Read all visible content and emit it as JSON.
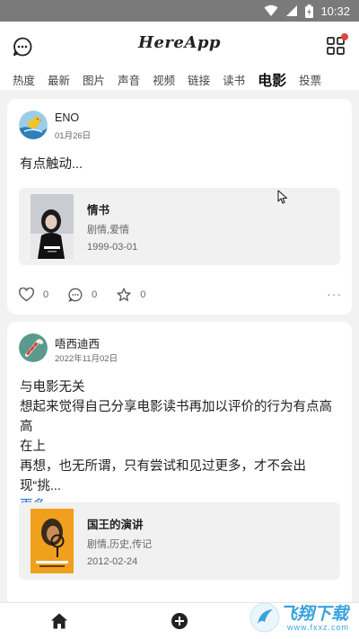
{
  "status": {
    "time": "10:32"
  },
  "header": {
    "title": "HereApp",
    "tabs": [
      {
        "label": "热度"
      },
      {
        "label": "最新"
      },
      {
        "label": "图片"
      },
      {
        "label": "声音"
      },
      {
        "label": "视频"
      },
      {
        "label": "链接"
      },
      {
        "label": "读书"
      },
      {
        "label": "电影",
        "active": true
      },
      {
        "label": "投票"
      }
    ]
  },
  "posts": [
    {
      "author": "ENO",
      "date": "01月26日",
      "text_lines": [
        "有点触动..."
      ],
      "movie": {
        "title": "情书",
        "genre": "剧情,爱情",
        "release": "1999-03-01"
      },
      "likes": "0",
      "comments": "0",
      "stars": "0"
    },
    {
      "author": "唔西迪西",
      "date": "2022年11月02日",
      "text_lines": [
        "与电影无关",
        "想起来觉得自己分享电影读书再加以评价的行为有点高高",
        "在上",
        "再想，也无所谓，只有尝试和见过更多，才不会出现“挑..."
      ],
      "more_label": "更多",
      "movie": {
        "title": "国王的演讲",
        "genre": "剧情,历史,传记",
        "release": "2012-02-24"
      }
    }
  ],
  "watermark": {
    "text": "飞翔下载",
    "sub": "www.fxxz.com"
  },
  "colors": {
    "link": "#1f74c9",
    "notify": "#e0443f",
    "status_bar": "#7a7a7a"
  }
}
